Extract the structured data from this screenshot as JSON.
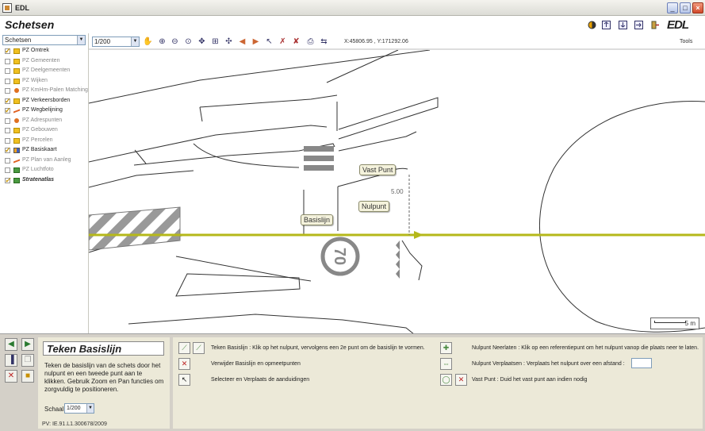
{
  "window": {
    "title": "EDL",
    "minimize": "_",
    "maximize": "□",
    "close": "×"
  },
  "header": {
    "title": "Schetsen",
    "logo": "EDL"
  },
  "sidebar": {
    "select_value": "Schetsen",
    "layers": [
      {
        "label": "PZ Omtrek",
        "checked": true,
        "icon": "folder-icon"
      },
      {
        "label": "PZ Gemeenten",
        "checked": false,
        "icon": "folder-icon"
      },
      {
        "label": "PZ Deelgemeenten",
        "checked": false,
        "icon": "folder-icon"
      },
      {
        "label": "PZ Wijken",
        "checked": false,
        "icon": "folder-icon"
      },
      {
        "label": "PZ KmHm-Palen Matching",
        "checked": false,
        "icon": "point-icon"
      },
      {
        "label": "PZ Verkeersborden",
        "checked": true,
        "icon": "folder-icon"
      },
      {
        "label": "PZ Wegbelijning",
        "checked": true,
        "icon": "line-icon"
      },
      {
        "label": "PZ Adrespunten",
        "checked": false,
        "icon": "point-icon"
      },
      {
        "label": "PZ Gebouwen",
        "checked": false,
        "icon": "folder-icon"
      },
      {
        "label": "PZ Percelen",
        "checked": false,
        "icon": "folder-icon"
      },
      {
        "label": "PZ Basiskaart",
        "checked": true,
        "icon": "multi-icon"
      },
      {
        "label": "PZ Plan van Aanleg",
        "checked": false,
        "icon": "line-icon"
      },
      {
        "label": "PZ Luchtfoto",
        "checked": false,
        "icon": "green-icon"
      },
      {
        "label": "Stratenatlas",
        "checked": true,
        "icon": "green-icon"
      }
    ]
  },
  "toolbar": {
    "scale_value": "1/200",
    "coords": "X:45806.95 , Y:171292.06",
    "tools_label": "Tools"
  },
  "map": {
    "callouts": {
      "vast_punt": "Vast Punt",
      "nulpunt": "Nulpunt",
      "basislijn": "Basislijn"
    },
    "distance": "5.00",
    "speed_sign": "70",
    "scalebar": "5 m"
  },
  "bottom": {
    "instr_title": "Teken Basislijn",
    "instr_text": "Teken de basislijn van de schets door het nulpunt en een tweede punt aan te klikken.  Gebruik Zoom en Pan functies om zorgvuldig te positioneren.",
    "schaal_label": "Schaal:",
    "schaal_value": "1/200",
    "pv": "PV: IE.91.L1.300678/2009",
    "actions": {
      "teken_basislijn": "Teken Basislijn : Klik op het nulpunt, vervolgens een 2e punt om de basislijn te vormen.",
      "verwijder": "Verwijder Basislijn en opmeetpunten",
      "selecteer": "Selecteer en Verplaats de aanduidingen",
      "nulpunt_neerlaten": "Nulpunt Neerlaten : Klik op een referentiepunt om het nulpunt vanop die plaats neer te laten.",
      "nulpunt_verplaatsen": "Nulpunt Verplaatsen : Verplaats het nulpunt over een afstand :",
      "vast_punt": "Vast Punt : Duid het vast punt aan indien nodig"
    }
  },
  "colors": {
    "baseline": "#b5b81a",
    "accent": "#c39000"
  }
}
